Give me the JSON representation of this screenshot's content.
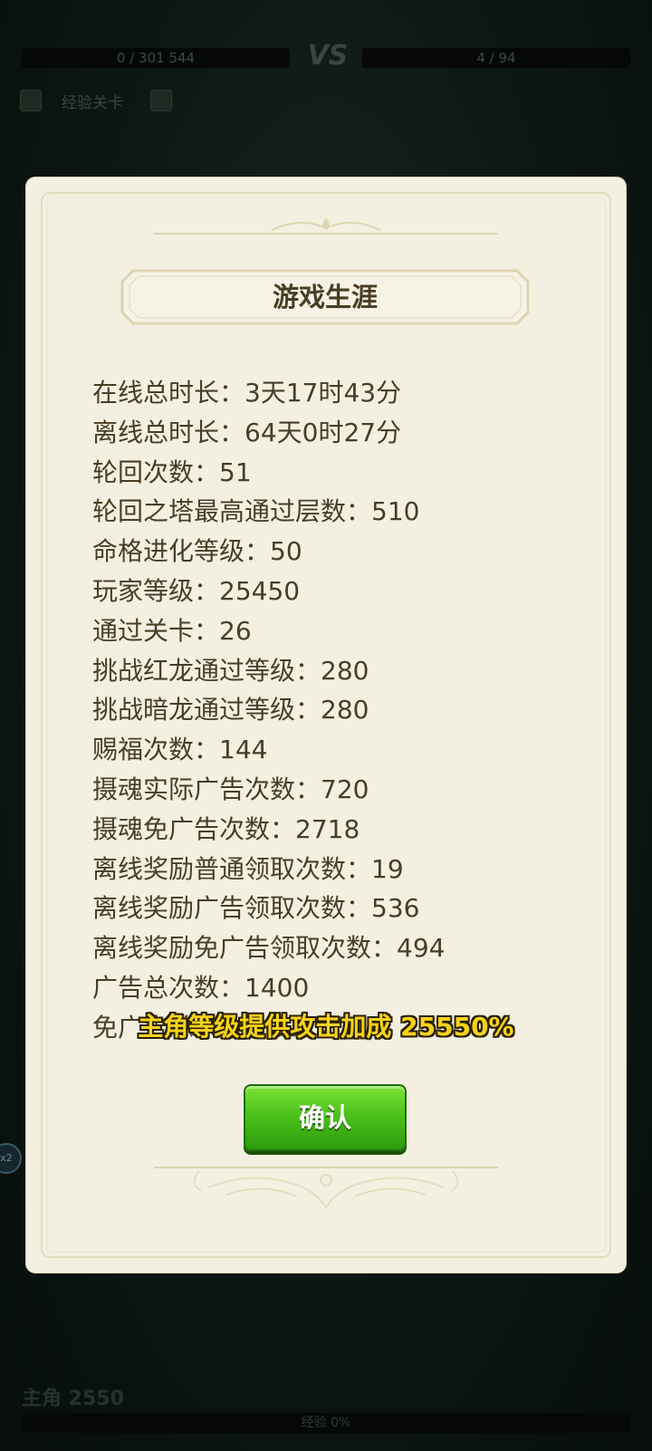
{
  "hud": {
    "left_hp": "0 / 301 544",
    "vs": "VS",
    "right_hp": "4 / 94",
    "stage_label": "经验关卡"
  },
  "side_badge": "x2",
  "bottom": {
    "title": "主角 2550",
    "right_text": "…",
    "exp": "经验 0%"
  },
  "dialog": {
    "title": "游戏生涯",
    "stats": [
      "在线总时长：3天17时43分",
      "离线总时长：64天0时27分",
      "轮回次数：51",
      "轮回之塔最高通过层数：510",
      "命格进化等级：50",
      "玩家等级：25450",
      "通过关卡：26",
      "挑战红龙通过等级：280",
      "挑战暗龙通过等级：280",
      "赐福次数：144",
      "摄魂实际广告次数：720",
      "摄魂免广告次数：2718",
      "离线奖励普通领取次数：19",
      "离线奖励广告领取次数：536",
      "离线奖励免广告领取次数：494",
      "广告总次数：1400",
      "免广告总次数：3212"
    ],
    "toast": "主角等级提供攻击加成 25550%",
    "confirm_label": "确认"
  },
  "colors": {
    "panel_bg": "#f3f0e2",
    "text": "#4a3d25",
    "button_green": "#4cc21b",
    "toast_yellow": "#f6d21a"
  }
}
